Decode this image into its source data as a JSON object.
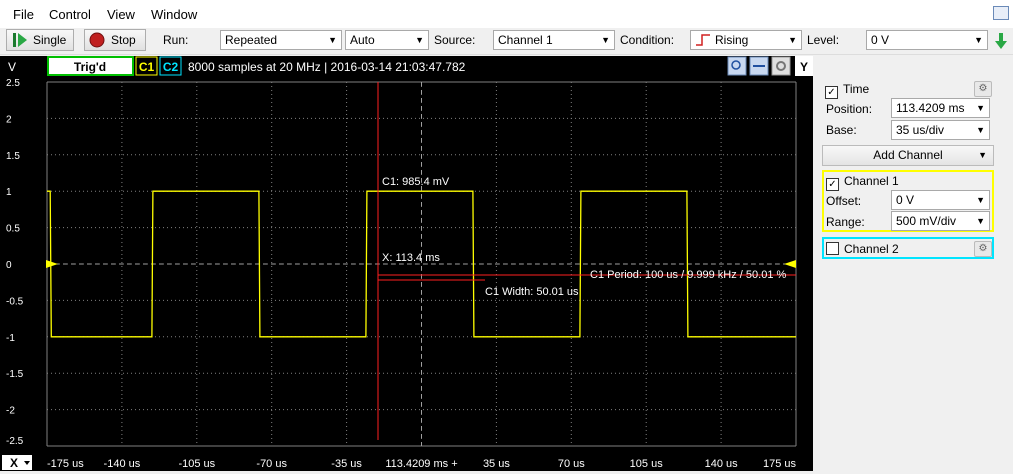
{
  "menu": [
    "File",
    "Control",
    "View",
    "Window"
  ],
  "toolbar": {
    "single": "Single",
    "stop": "Stop",
    "run_label": "Run:",
    "run_mode": "Repeated",
    "run_auto": "Auto",
    "source_label": "Source:",
    "source": "Channel 1",
    "condition_label": "Condition:",
    "condition": "Rising",
    "level_label": "Level:",
    "level": "0 V"
  },
  "header": {
    "v_label": "V",
    "trig": "Trig'd",
    "c1": "C1",
    "c2": "C2",
    "info": "8000 samples at 20 MHz | 2016-03-14 21:03:47.782",
    "y_label": "Y"
  },
  "panel": {
    "time_label": "Time",
    "position_label": "Position:",
    "position": "113.4209 ms",
    "base_label": "Base:",
    "base": "35 us/div",
    "add_channel": "Add Channel",
    "ch1_label": "Channel 1",
    "offset_label": "Offset:",
    "offset": "0 V",
    "range_label": "Range:",
    "range": "500 mV/div",
    "ch2_label": "Channel 2"
  },
  "colors": {
    "ch1": "#ffff00",
    "ch2": "#00e5ff",
    "cursor": "#ff2020",
    "grid": "#808080"
  },
  "chart_data": {
    "type": "line",
    "y_ticks": [
      "2.5",
      "2",
      "1.5",
      "1",
      "0.5",
      "0",
      "-0.5",
      "-1",
      "-1.5",
      "-2",
      "-2.5"
    ],
    "x_ticks": [
      "-175 us",
      "-140 us",
      "-105 us",
      "-70 us",
      "-35 us",
      "113.4209 ms +",
      "35 us",
      "70 us",
      "105 us",
      "140 us",
      "175 us"
    ],
    "xlim": [
      -175,
      175
    ],
    "ylim": [
      -2.5,
      2.5
    ],
    "series": [
      {
        "name": "C1",
        "points": [
          [
            -175,
            1
          ],
          [
            -173.5,
            1
          ],
          [
            -173,
            -1
          ],
          [
            -126,
            -1
          ],
          [
            -125.5,
            1
          ],
          [
            -76,
            1
          ],
          [
            -75.5,
            -1
          ],
          [
            -26,
            -1
          ],
          [
            -25.5,
            1
          ],
          [
            24,
            1
          ],
          [
            24.5,
            -1
          ],
          [
            74,
            -1
          ],
          [
            74.5,
            1
          ],
          [
            124,
            1
          ],
          [
            124.5,
            -1
          ],
          [
            175,
            -1
          ]
        ]
      }
    ],
    "annotations": {
      "cursor_value": "C1: 985.4 mV",
      "cursor_x": "X: 113.4 ms",
      "period": "C1 Period: 100 us / 9.999 kHz / 50.01 %",
      "width": "C1 Width: 50.01 us"
    }
  }
}
